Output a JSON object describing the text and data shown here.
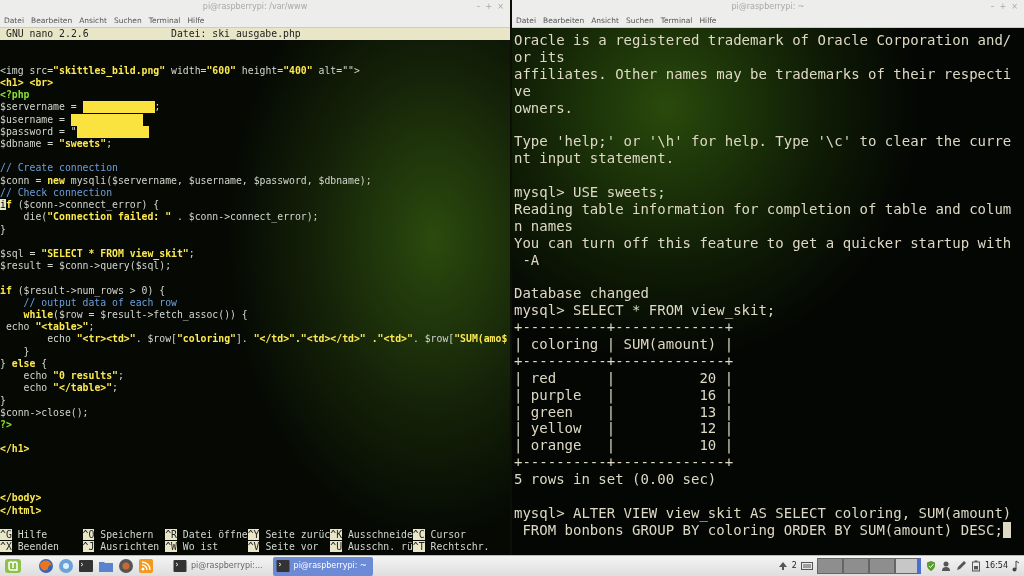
{
  "left_window": {
    "title": "pi@raspberrypi: /var/www",
    "controls": [
      "–",
      "+",
      "×"
    ],
    "menu": [
      "Datei",
      "Bearbeiten",
      "Ansicht",
      "Suchen",
      "Terminal",
      "Hilfe"
    ],
    "nano_header": {
      "version": "GNU nano 2.2.6",
      "file": "Datei: ski_ausgabe.php"
    },
    "lines": [
      {
        "kind": "blank"
      },
      {
        "kind": "blank"
      },
      {
        "kind": "code",
        "segments": [
          {
            "kind": "plain",
            "text": "<img src="
          },
          {
            "kind": "string",
            "text": "\"skittles_bild.png\""
          },
          {
            "kind": "plain",
            "text": " width="
          },
          {
            "kind": "string",
            "text": "\"600\""
          },
          {
            "kind": "plain",
            "text": " height="
          },
          {
            "kind": "string",
            "text": "\"400\""
          },
          {
            "kind": "plain",
            "text": " alt=\"\">"
          }
        ]
      },
      {
        "kind": "code",
        "segments": [
          {
            "kind": "tag",
            "text": "<h1> <br>"
          }
        ]
      },
      {
        "kind": "code",
        "segments": [
          {
            "kind": "php",
            "text": "<?php"
          }
        ]
      },
      {
        "kind": "code",
        "segments": [
          {
            "kind": "plain",
            "text": "$servername = "
          },
          {
            "kind": "redacted"
          },
          {
            "kind": "plain",
            "text": ";"
          }
        ]
      },
      {
        "kind": "code",
        "segments": [
          {
            "kind": "plain",
            "text": "$username = "
          },
          {
            "kind": "redacted"
          }
        ]
      },
      {
        "kind": "code",
        "segments": [
          {
            "kind": "plain",
            "text": "$password = \""
          },
          {
            "kind": "redacted"
          }
        ]
      },
      {
        "kind": "code",
        "segments": [
          {
            "kind": "plain",
            "text": "$dbname = "
          },
          {
            "kind": "string",
            "text": "\"sweets\""
          },
          {
            "kind": "plain",
            "text": ";"
          }
        ]
      },
      {
        "kind": "blank"
      },
      {
        "kind": "code",
        "segments": [
          {
            "kind": "comment",
            "text": "// Create connection"
          }
        ]
      },
      {
        "kind": "code",
        "segments": [
          {
            "kind": "plain",
            "text": "$conn = "
          },
          {
            "kind": "keyword",
            "text": "new"
          },
          {
            "kind": "plain",
            "text": " mysqli($servername, $username, $password, $dbname);"
          }
        ]
      },
      {
        "kind": "code",
        "segments": [
          {
            "kind": "comment",
            "text": "// Check connection"
          }
        ]
      },
      {
        "kind": "code",
        "segments": [
          {
            "kind": "cursor",
            "text": "i"
          },
          {
            "kind": "keyword",
            "text": "f"
          },
          {
            "kind": "plain",
            "text": " ($conn->connect_error) {"
          }
        ]
      },
      {
        "kind": "code",
        "segments": [
          {
            "kind": "plain",
            "text": "    die("
          },
          {
            "kind": "string",
            "text": "\"Connection failed: \""
          },
          {
            "kind": "plain",
            "text": " . $conn->connect_error);"
          }
        ]
      },
      {
        "kind": "code",
        "segments": [
          {
            "kind": "plain",
            "text": "}"
          }
        ]
      },
      {
        "kind": "blank"
      },
      {
        "kind": "code",
        "segments": [
          {
            "kind": "plain",
            "text": "$sql = "
          },
          {
            "kind": "string",
            "text": "\"SELECT * FROM view_skit\""
          },
          {
            "kind": "plain",
            "text": ";"
          }
        ]
      },
      {
        "kind": "code",
        "segments": [
          {
            "kind": "plain",
            "text": "$result = $conn->query($sql);"
          }
        ]
      },
      {
        "kind": "blank"
      },
      {
        "kind": "code",
        "segments": [
          {
            "kind": "keyword",
            "text": "if"
          },
          {
            "kind": "plain",
            "text": " ($result->num_rows > 0) {"
          }
        ]
      },
      {
        "kind": "code",
        "segments": [
          {
            "kind": "comment",
            "text": "    // output data of each row"
          }
        ]
      },
      {
        "kind": "code",
        "segments": [
          {
            "kind": "keyword",
            "text": "    while"
          },
          {
            "kind": "plain",
            "text": "($row = $result->fetch_assoc()) {"
          }
        ]
      },
      {
        "kind": "code",
        "segments": [
          {
            "kind": "plain",
            "text": " echo "
          },
          {
            "kind": "string",
            "text": "\"<table>\""
          },
          {
            "kind": "plain",
            "text": ";"
          }
        ]
      },
      {
        "kind": "code",
        "segments": [
          {
            "kind": "plain",
            "text": "        echo "
          },
          {
            "kind": "string",
            "text": "\"<tr><td>\""
          },
          {
            "kind": "plain",
            "text": ". $row["
          },
          {
            "kind": "string",
            "text": "\"coloring\""
          },
          {
            "kind": "plain",
            "text": "]. "
          },
          {
            "kind": "string",
            "text": "\"</td>\".\"<td></td>\""
          },
          {
            "kind": "string",
            "text": " .\"<td>\""
          },
          {
            "kind": "plain",
            "text": ". $row["
          },
          {
            "kind": "string",
            "text": "\"SUM(amo$"
          }
        ]
      },
      {
        "kind": "code",
        "segments": [
          {
            "kind": "plain",
            "text": "    }"
          }
        ]
      },
      {
        "kind": "code",
        "segments": [
          {
            "kind": "plain",
            "text": "} "
          },
          {
            "kind": "keyword",
            "text": "else"
          },
          {
            "kind": "plain",
            "text": " {"
          }
        ]
      },
      {
        "kind": "code",
        "segments": [
          {
            "kind": "plain",
            "text": "    echo "
          },
          {
            "kind": "string",
            "text": "\"0 results\""
          },
          {
            "kind": "plain",
            "text": ";"
          }
        ]
      },
      {
        "kind": "code",
        "segments": [
          {
            "kind": "plain",
            "text": "    echo "
          },
          {
            "kind": "string",
            "text": "\"</table>\""
          },
          {
            "kind": "plain",
            "text": ";"
          }
        ]
      },
      {
        "kind": "code",
        "segments": [
          {
            "kind": "plain",
            "text": "}"
          }
        ]
      },
      {
        "kind": "code",
        "segments": [
          {
            "kind": "plain",
            "text": "$conn->close();"
          }
        ]
      },
      {
        "kind": "code",
        "segments": [
          {
            "kind": "php",
            "text": "?>"
          }
        ]
      },
      {
        "kind": "blank"
      },
      {
        "kind": "code",
        "segments": [
          {
            "kind": "tag",
            "text": "</h1>"
          }
        ]
      },
      {
        "kind": "blank"
      },
      {
        "kind": "blank"
      },
      {
        "kind": "blank"
      },
      {
        "kind": "code",
        "segments": [
          {
            "kind": "tag",
            "text": "</body>"
          }
        ]
      },
      {
        "kind": "code",
        "segments": [
          {
            "kind": "tag",
            "text": "</html>"
          }
        ]
      },
      {
        "kind": "blank"
      }
    ],
    "shortcuts": [
      [
        {
          "key": "^G",
          "label": "Hilfe"
        },
        {
          "key": "^O",
          "label": "Speichern"
        },
        {
          "key": "^R",
          "label": "Datei öffne"
        },
        {
          "key": "^Y",
          "label": "Seite zurüc"
        },
        {
          "key": "^K",
          "label": "Ausschneide"
        },
        {
          "key": "^C",
          "label": "Cursor"
        }
      ],
      [
        {
          "key": "^X",
          "label": "Beenden"
        },
        {
          "key": "^J",
          "label": "Ausrichten"
        },
        {
          "key": "^W",
          "label": "Wo ist"
        },
        {
          "key": "^V",
          "label": "Seite vor"
        },
        {
          "key": "^U",
          "label": "Ausschn. rü"
        },
        {
          "key": "^T",
          "label": "Rechtschr."
        }
      ]
    ]
  },
  "right_window": {
    "title": "pi@raspberrypi: ~",
    "controls": [
      "–",
      "+",
      "×"
    ],
    "menu": [
      "Datei",
      "Bearbeiten",
      "Ansicht",
      "Suchen",
      "Terminal",
      "Hilfe"
    ],
    "lines": [
      {
        "kind": "text",
        "text": "Oracle is a registered trademark of Oracle Corporation and/"
      },
      {
        "kind": "text",
        "text": "or its"
      },
      {
        "kind": "text",
        "text": "affiliates. Other names may be trademarks of their respecti"
      },
      {
        "kind": "text",
        "text": "ve"
      },
      {
        "kind": "text",
        "text": "owners."
      },
      {
        "kind": "blank"
      },
      {
        "kind": "text",
        "text": "Type 'help;' or '\\h' for help. Type '\\c' to clear the curre"
      },
      {
        "kind": "text",
        "text": "nt input statement."
      },
      {
        "kind": "blank"
      },
      {
        "kind": "text",
        "text": "mysql> USE sweets;"
      },
      {
        "kind": "text",
        "text": "Reading table information for completion of table and colum"
      },
      {
        "kind": "text",
        "text": "n names"
      },
      {
        "kind": "text",
        "text": "You can turn off this feature to get a quicker startup with"
      },
      {
        "kind": "text",
        "text": " -A"
      },
      {
        "kind": "blank"
      },
      {
        "kind": "text",
        "text": "Database changed"
      },
      {
        "kind": "text",
        "text": "mysql> SELECT * FROM view_skit;"
      },
      {
        "kind": "text",
        "text": "+----------+-------------+"
      },
      {
        "kind": "text",
        "text": "| coloring | SUM(amount) |"
      },
      {
        "kind": "text",
        "text": "+----------+-------------+"
      },
      {
        "kind": "text",
        "text": "| red      |          20 |"
      },
      {
        "kind": "text",
        "text": "| purple   |          16 |"
      },
      {
        "kind": "text",
        "text": "| green    |          13 |"
      },
      {
        "kind": "text",
        "text": "| yellow   |          12 |"
      },
      {
        "kind": "text",
        "text": "| orange   |          10 |"
      },
      {
        "kind": "text",
        "text": "+----------+-------------+"
      },
      {
        "kind": "text",
        "text": "5 rows in set (0.00 sec)"
      },
      {
        "kind": "blank"
      },
      {
        "kind": "text",
        "text": "mysql> ALTER VIEW view_skit AS SELECT coloring, SUM(amount)"
      },
      {
        "kind": "text",
        "text": " FROM bonbons GROUP BY coloring ORDER BY SUM(amount) DESC;",
        "cursor": true
      }
    ]
  },
  "taskbar": {
    "windows": [
      {
        "label": "pi@raspberrypi:...",
        "selected": false
      },
      {
        "label": "pi@raspberrypi: ~",
        "selected": true
      }
    ],
    "update_count": "2",
    "workspaces": [
      {
        "selected": false
      },
      {
        "selected": false
      },
      {
        "selected": false
      },
      {
        "selected": true
      }
    ],
    "clock": "16:54"
  }
}
